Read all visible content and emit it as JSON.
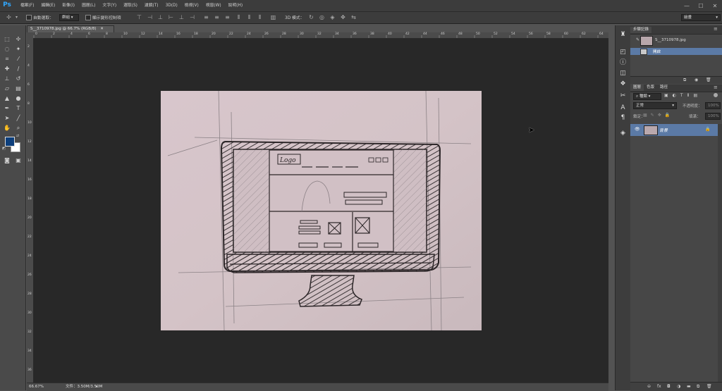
{
  "app": {
    "logo": "Ps"
  },
  "menubar": {
    "items": [
      "檔案(F)",
      "編輯(E)",
      "影像(I)",
      "圖層(L)",
      "文字(Y)",
      "選取(S)",
      "濾鏡(T)",
      "3D(D)",
      "檢視(V)",
      "視窗(W)",
      "說明(H)"
    ],
    "window_controls": [
      "—",
      "☐",
      "✕"
    ]
  },
  "options_bar": {
    "auto_select_label": "自動選取：",
    "auto_select_value": "群組",
    "show_transform_label": "顯示變形控制項",
    "mode_3d_label": "3D 模式：",
    "workspace_value": "繪畫"
  },
  "document": {
    "tab_title": "S__3710978.jpg @ 66.7% (RGB/8)",
    "ruler_ticks": [
      "0",
      "2",
      "4",
      "6",
      "8",
      "10",
      "12",
      "14",
      "16",
      "18",
      "20",
      "22",
      "24",
      "26",
      "28",
      "30",
      "32",
      "34",
      "36",
      "38",
      "40",
      "42",
      "44",
      "46",
      "48",
      "50",
      "52",
      "54",
      "56",
      "58",
      "60",
      "62",
      "64"
    ],
    "left_ticks": [
      "2",
      "4",
      "6",
      "8",
      "10",
      "12",
      "14",
      "16",
      "18",
      "20",
      "22",
      "24",
      "26",
      "28",
      "30",
      "32",
      "34",
      "36"
    ],
    "sketch_logo_text": "Logo"
  },
  "status_bar": {
    "zoom": "66.67%",
    "file_info": "文件：3.50M/3.50M"
  },
  "history_panel": {
    "tab_label": "步驟記錄",
    "snapshot_name": "S__3710978.jpg",
    "step_name": "開啟"
  },
  "layers_panel": {
    "tabs": [
      "圖層",
      "色版",
      "路徑"
    ],
    "filter_kind": "種類",
    "blend_mode": "正常",
    "opacity_label": "不透明度：",
    "opacity_value": "100%",
    "lock_label": "鎖定：",
    "fill_label": "填滿：",
    "fill_value": "100%",
    "layer_name": "背景"
  }
}
